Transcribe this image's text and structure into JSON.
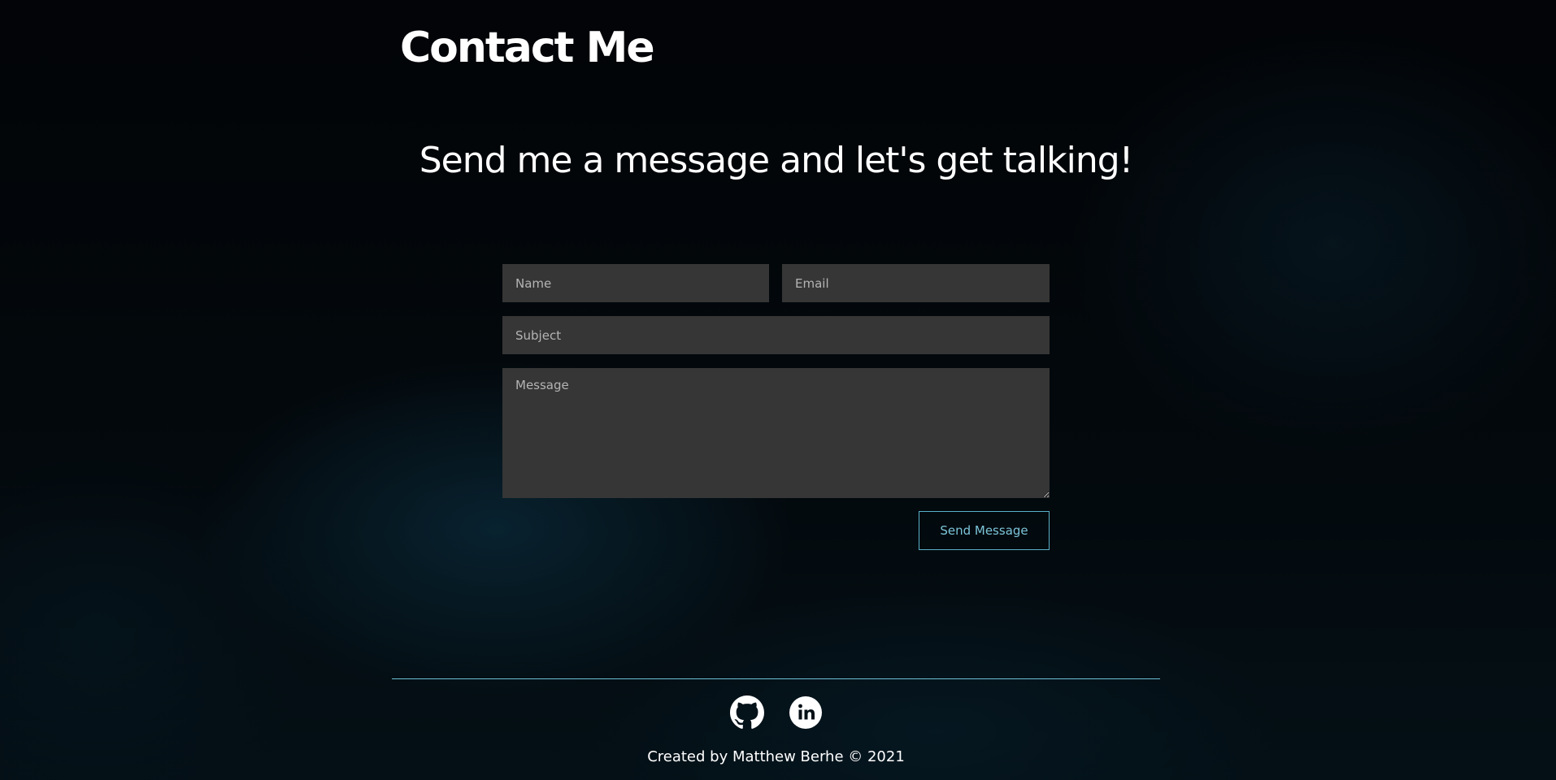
{
  "header": {
    "title": "Contact Me"
  },
  "main": {
    "tagline": "Send me a message and let's get talking!"
  },
  "form": {
    "name_placeholder": "Name",
    "name_value": "",
    "email_placeholder": "Email",
    "email_value": "",
    "subject_placeholder": "Subject",
    "subject_value": "",
    "message_placeholder": "Message",
    "message_value": "",
    "submit_label": "Send Message"
  },
  "footer": {
    "social": [
      {
        "name": "github",
        "icon": "github-icon"
      },
      {
        "name": "linkedin",
        "icon": "linkedin-icon"
      }
    ],
    "credit": "Created by Matthew Berhe © 2021"
  },
  "colors": {
    "background": "#020507",
    "field_background": "#363636",
    "placeholder": "#b4b4b4",
    "accent": "#5ab0c8",
    "text": "#ffffff"
  }
}
